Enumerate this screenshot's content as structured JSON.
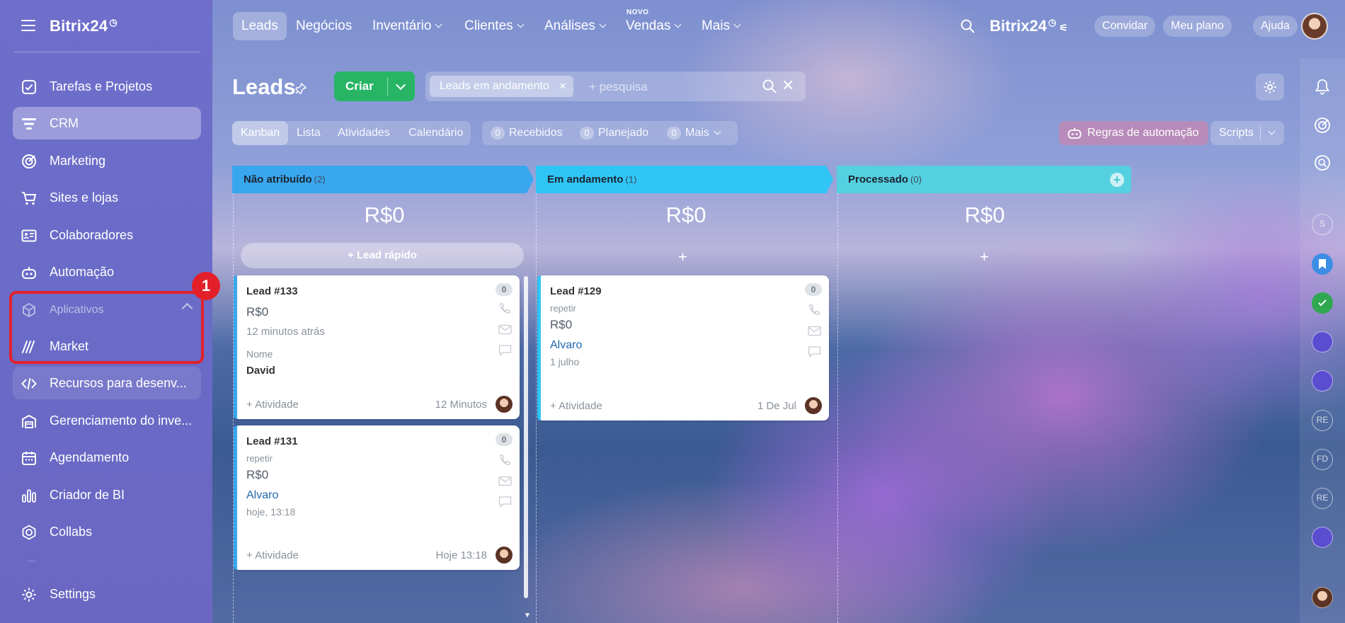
{
  "sidebar": {
    "logo": "Bitrix24",
    "items": [
      {
        "label": "Tarefas e Projetos",
        "icon": "checkbox-icon"
      },
      {
        "label": "CRM",
        "icon": "crm-filter-icon"
      },
      {
        "label": "Marketing",
        "icon": "target-icon"
      },
      {
        "label": "Sites e lojas",
        "icon": "cart-icon"
      },
      {
        "label": "Colaboradores",
        "icon": "id-card-icon"
      },
      {
        "label": "Automação",
        "icon": "robot-icon"
      },
      {
        "label": "Aplicativos",
        "icon": "cube-icon"
      },
      {
        "label": "Market",
        "icon": "market-icon"
      },
      {
        "label": "Recursos para desenv...",
        "icon": "code-icon"
      },
      {
        "label": "Gerenciamento do inve...",
        "icon": "warehouse-icon"
      },
      {
        "label": "Agendamento",
        "icon": "calendar-icon"
      },
      {
        "label": "Criador de BI",
        "icon": "bar-chart-icon"
      },
      {
        "label": "Collabs",
        "icon": "collabs-icon"
      },
      {
        "label": "Settings",
        "icon": "gear-icon"
      }
    ],
    "step_badge": "1"
  },
  "topnav": {
    "items": [
      {
        "label": "Leads"
      },
      {
        "label": "Negócios"
      },
      {
        "label": "Inventário"
      },
      {
        "label": "Clientes"
      },
      {
        "label": "Análises"
      },
      {
        "label": "Vendas",
        "badge": "NOVO"
      },
      {
        "label": "Mais"
      }
    ],
    "logo": "Bitrix24",
    "invite": "Convidar",
    "plan": "Meu plano",
    "help": "Ajuda"
  },
  "page": {
    "title": "Leads",
    "create_label": "Criar",
    "filter_chip": "Leads em andamento",
    "search_placeholder": "+ pesquisa"
  },
  "views": {
    "tabs": [
      "Kanban",
      "Lista",
      "Atividades",
      "Calendário"
    ],
    "counters": [
      {
        "num": "0",
        "label": "Recebidos"
      },
      {
        "num": "0",
        "label": "Planejado"
      },
      {
        "num": "0",
        "label": "Mais"
      }
    ],
    "robots_label": "Regras de automação",
    "scripts_label": "Scripts"
  },
  "columns": [
    {
      "name": "Não atribuído",
      "count": "(2)",
      "sum": "R$0",
      "add_label": "Lead rápido",
      "color": "#39a7ef"
    },
    {
      "name": "Em andamento",
      "count": "(1)",
      "sum": "R$0",
      "add_label": "+",
      "color": "#2fc6f5"
    },
    {
      "name": "Processado",
      "count": "(0)",
      "sum": "R$0",
      "add_label": "+",
      "color": "#55d0e0"
    }
  ],
  "cards": [
    {
      "title": "Lead #133",
      "badge": "0",
      "price": "R$0",
      "time": "12 minutos atrás",
      "field_label": "Nome",
      "field_value": "David",
      "activity": "+ Atividade",
      "stamp": "12 Minutos"
    },
    {
      "title": "Lead #131",
      "badge": "0",
      "sub": "repetir",
      "price": "R$0",
      "contact": "Alvaro",
      "time": "hoje, 13:18",
      "activity": "+ Atividade",
      "stamp": "Hoje 13:18"
    },
    {
      "title": "Lead #129",
      "badge": "0",
      "sub": "repetir",
      "price": "R$0",
      "contact": "Alvaro",
      "time": "1 julho",
      "activity": "+ Atividade",
      "stamp": "1 De Jul"
    }
  ],
  "rail": {
    "circles": [
      "S",
      "RE",
      "FD",
      "RE"
    ]
  }
}
